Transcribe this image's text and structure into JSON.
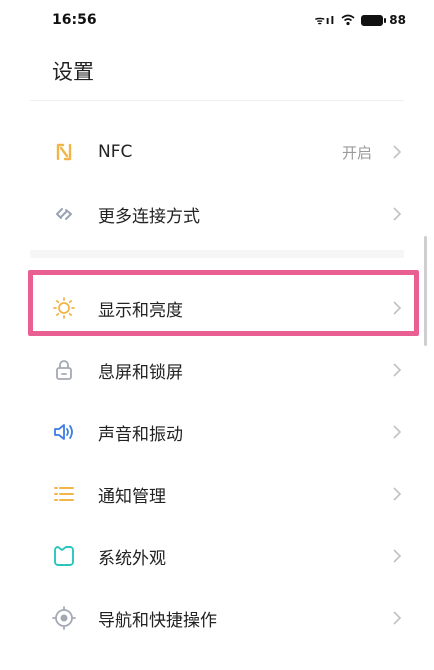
{
  "status_bar": {
    "time": "16:56",
    "signal": "ᯤıl",
    "battery": "88"
  },
  "header": {
    "title": "设置"
  },
  "settings": [
    {
      "label": "NFC",
      "value": "开启",
      "icon": "nfc-icon",
      "icon_color": "#f2b54a"
    },
    {
      "label": "更多连接方式",
      "value": "",
      "icon": "link-icon",
      "icon_color": "#9aa3b5"
    },
    {
      "label": "显示和亮度",
      "value": "",
      "icon": "brightness-icon",
      "icon_color": "#f2b54a"
    },
    {
      "label": "息屏和锁屏",
      "value": "",
      "icon": "lock-icon",
      "icon_color": "#a5a9b5"
    },
    {
      "label": "声音和振动",
      "value": "",
      "icon": "speaker-icon",
      "icon_color": "#3d7de6"
    },
    {
      "label": "通知管理",
      "value": "",
      "icon": "list-icon",
      "icon_color": "#f2b54a"
    },
    {
      "label": "系统外观",
      "value": "",
      "icon": "appearance-icon",
      "icon_color": "#2bc5c0"
    },
    {
      "label": "导航和快捷操作",
      "value": "",
      "icon": "navigation-icon",
      "icon_color": "#a5a9b5"
    }
  ],
  "highlight_color": "#ea5f92"
}
